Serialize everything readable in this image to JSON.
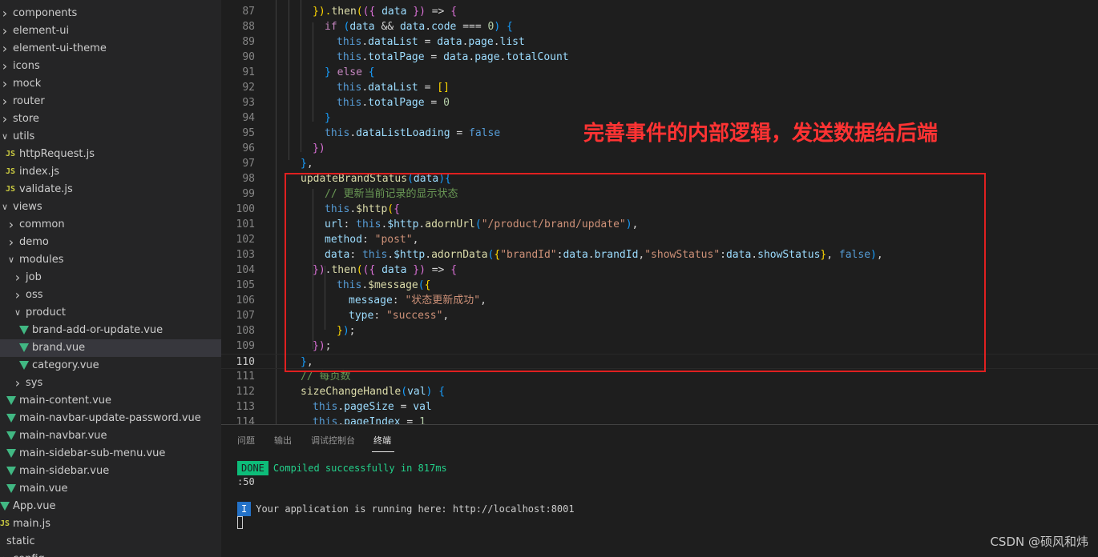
{
  "explorer": {
    "items": [
      {
        "label": "components",
        "kind": "folder",
        "open": false
      },
      {
        "label": "element-ui",
        "kind": "folder",
        "open": false
      },
      {
        "label": "element-ui-theme",
        "kind": "folder",
        "open": false
      },
      {
        "label": "icons",
        "kind": "folder",
        "open": false
      },
      {
        "label": "mock",
        "kind": "folder",
        "open": false
      },
      {
        "label": "router",
        "kind": "folder",
        "open": false
      },
      {
        "label": "store",
        "kind": "folder",
        "open": false
      },
      {
        "label": "utils",
        "kind": "folder",
        "open": true
      },
      {
        "label": "httpRequest.js",
        "kind": "js",
        "icon_text": "JS"
      },
      {
        "label": "index.js",
        "kind": "js",
        "icon_text": "JS"
      },
      {
        "label": "validate.js",
        "kind": "js",
        "icon_text": "JS"
      },
      {
        "label": "views",
        "kind": "folder",
        "open": true
      },
      {
        "label": "common",
        "kind": "folder",
        "open": false
      },
      {
        "label": "demo",
        "kind": "folder",
        "open": false
      },
      {
        "label": "modules",
        "kind": "folder",
        "open": true
      },
      {
        "label": "job",
        "kind": "folder",
        "open": false
      },
      {
        "label": "oss",
        "kind": "folder",
        "open": false
      },
      {
        "label": "product",
        "kind": "folder",
        "open": true
      },
      {
        "label": "brand-add-or-update.vue",
        "kind": "vue"
      },
      {
        "label": "brand.vue",
        "kind": "vue",
        "selected": true
      },
      {
        "label": "category.vue",
        "kind": "vue"
      },
      {
        "label": "sys",
        "kind": "folder",
        "open": false
      },
      {
        "label": "main-content.vue",
        "kind": "vue"
      },
      {
        "label": "main-navbar-update-password.vue",
        "kind": "vue"
      },
      {
        "label": "main-navbar.vue",
        "kind": "vue"
      },
      {
        "label": "main-sidebar-sub-menu.vue",
        "kind": "vue"
      },
      {
        "label": "main-sidebar.vue",
        "kind": "vue"
      },
      {
        "label": "main.vue",
        "kind": "vue"
      },
      {
        "label": "App.vue",
        "kind": "vue"
      },
      {
        "label": "main.js",
        "kind": "js",
        "icon_text": "JS"
      },
      {
        "label": "static",
        "kind": "folder",
        "open": true
      },
      {
        "label": "config",
        "kind": "folder",
        "open": false
      }
    ]
  },
  "editor": {
    "active_line": "110",
    "lines": [
      {
        "n": "87",
        "tokens": [
          [
            "p",
            "})."
          ],
          [
            "fn",
            "then"
          ],
          [
            "p1",
            "("
          ],
          [
            "p2",
            "({"
          ],
          [
            "prop",
            " data "
          ],
          [
            "p2",
            "})"
          ],
          [
            "op",
            " => "
          ],
          [
            "p2",
            "{"
          ]
        ]
      },
      {
        "n": "88",
        "tokens": [
          [
            "kw",
            "if"
          ],
          [
            "op",
            " "
          ],
          [
            "p3",
            "("
          ],
          [
            "prop",
            "data"
          ],
          [
            "op",
            " && "
          ],
          [
            "prop",
            "data"
          ],
          [
            "op",
            "."
          ],
          [
            "prop",
            "code"
          ],
          [
            "op",
            " === "
          ],
          [
            "num",
            "0"
          ],
          [
            "p3",
            ")"
          ],
          [
            "op",
            " "
          ],
          [
            "p3",
            "{"
          ]
        ]
      },
      {
        "n": "89",
        "tokens": [
          [
            "this",
            "this"
          ],
          [
            "op",
            "."
          ],
          [
            "prop",
            "dataList"
          ],
          [
            "op",
            " = "
          ],
          [
            "prop",
            "data"
          ],
          [
            "op",
            "."
          ],
          [
            "prop",
            "page"
          ],
          [
            "op",
            "."
          ],
          [
            "prop",
            "list"
          ]
        ]
      },
      {
        "n": "90",
        "tokens": [
          [
            "this",
            "this"
          ],
          [
            "op",
            "."
          ],
          [
            "prop",
            "totalPage"
          ],
          [
            "op",
            " = "
          ],
          [
            "prop",
            "data"
          ],
          [
            "op",
            "."
          ],
          [
            "prop",
            "page"
          ],
          [
            "op",
            "."
          ],
          [
            "prop",
            "totalCount"
          ]
        ]
      },
      {
        "n": "91",
        "tokens": [
          [
            "p3",
            "}"
          ],
          [
            "op",
            " "
          ],
          [
            "kw",
            "else"
          ],
          [
            "op",
            " "
          ],
          [
            "p3",
            "{"
          ]
        ]
      },
      {
        "n": "92",
        "tokens": [
          [
            "this",
            "this"
          ],
          [
            "op",
            "."
          ],
          [
            "prop",
            "dataList"
          ],
          [
            "op",
            " = "
          ],
          [
            "p1",
            "[]"
          ]
        ]
      },
      {
        "n": "93",
        "tokens": [
          [
            "this",
            "this"
          ],
          [
            "op",
            "."
          ],
          [
            "prop",
            "totalPage"
          ],
          [
            "op",
            " = "
          ],
          [
            "num",
            "0"
          ]
        ]
      },
      {
        "n": "94",
        "tokens": [
          [
            "p3",
            "}"
          ]
        ]
      },
      {
        "n": "95",
        "tokens": [
          [
            "this",
            "this"
          ],
          [
            "op",
            "."
          ],
          [
            "prop",
            "dataListLoading"
          ],
          [
            "op",
            " = "
          ],
          [
            "this",
            "false"
          ]
        ]
      },
      {
        "n": "96",
        "tokens": [
          [
            "p2",
            "})"
          ]
        ]
      },
      {
        "n": "97",
        "tokens": [
          [
            "p3",
            "}"
          ],
          [
            "op",
            ","
          ]
        ]
      },
      {
        "n": "98",
        "tokens": [
          [
            "fn",
            "updateBrandStatus"
          ],
          [
            "p3",
            "("
          ],
          [
            "prop",
            "data"
          ],
          [
            "p3",
            ")"
          ],
          [
            "p3",
            "{"
          ]
        ]
      },
      {
        "n": "99",
        "tokens": [
          [
            "cm",
            "// 更新当前记录的显示状态"
          ]
        ]
      },
      {
        "n": "100",
        "tokens": [
          [
            "this",
            "this"
          ],
          [
            "op",
            "."
          ],
          [
            "fn",
            "$http"
          ],
          [
            "p1",
            "("
          ],
          [
            "p2",
            "{"
          ]
        ]
      },
      {
        "n": "101",
        "tokens": [
          [
            "prop",
            "url"
          ],
          [
            "op",
            ": "
          ],
          [
            "this",
            "this"
          ],
          [
            "op",
            "."
          ],
          [
            "prop",
            "$http"
          ],
          [
            "op",
            "."
          ],
          [
            "fn",
            "adornUrl"
          ],
          [
            "p3",
            "("
          ],
          [
            "str",
            "\"/product/brand/update\""
          ],
          [
            "p3",
            ")"
          ],
          [
            "op",
            ","
          ]
        ]
      },
      {
        "n": "102",
        "tokens": [
          [
            "prop",
            "method"
          ],
          [
            "op",
            ": "
          ],
          [
            "str",
            "\"post\""
          ],
          [
            "op",
            ","
          ]
        ]
      },
      {
        "n": "103",
        "tokens": [
          [
            "prop",
            "data"
          ],
          [
            "op",
            ": "
          ],
          [
            "this",
            "this"
          ],
          [
            "op",
            "."
          ],
          [
            "prop",
            "$http"
          ],
          [
            "op",
            "."
          ],
          [
            "fn",
            "adornData"
          ],
          [
            "p3",
            "("
          ],
          [
            "p1",
            "{"
          ],
          [
            "str",
            "\"brandId\""
          ],
          [
            "op",
            ":"
          ],
          [
            "prop",
            "data"
          ],
          [
            "op",
            "."
          ],
          [
            "prop",
            "brandId"
          ],
          [
            "op",
            ","
          ],
          [
            "str",
            "\"showStatus\""
          ],
          [
            "op",
            ":"
          ],
          [
            "prop",
            "data"
          ],
          [
            "op",
            "."
          ],
          [
            "prop",
            "showStatus"
          ],
          [
            "p1",
            "}"
          ],
          [
            "op",
            ", "
          ],
          [
            "this",
            "false"
          ],
          [
            "p3",
            ")"
          ],
          [
            "op",
            ","
          ]
        ]
      },
      {
        "n": "104",
        "tokens": [
          [
            "p2",
            "})"
          ],
          [
            "op",
            "."
          ],
          [
            "fn",
            "then"
          ],
          [
            "p1",
            "("
          ],
          [
            "p2",
            "({"
          ],
          [
            "prop",
            " data "
          ],
          [
            "p2",
            "})"
          ],
          [
            "op",
            " => "
          ],
          [
            "p2",
            "{"
          ]
        ]
      },
      {
        "n": "105",
        "tokens": [
          [
            "this",
            "this"
          ],
          [
            "op",
            "."
          ],
          [
            "fn",
            "$message"
          ],
          [
            "p3",
            "("
          ],
          [
            "p1",
            "{"
          ]
        ]
      },
      {
        "n": "106",
        "tokens": [
          [
            "prop",
            "message"
          ],
          [
            "op",
            ": "
          ],
          [
            "str",
            "\"状态更新成功\""
          ],
          [
            "op",
            ","
          ]
        ]
      },
      {
        "n": "107",
        "tokens": [
          [
            "prop",
            "type"
          ],
          [
            "op",
            ": "
          ],
          [
            "str",
            "\"success\""
          ],
          [
            "op",
            ","
          ]
        ]
      },
      {
        "n": "108",
        "tokens": [
          [
            "p1",
            "}"
          ],
          [
            "p3",
            ")"
          ],
          [
            "op",
            ";"
          ]
        ]
      },
      {
        "n": "109",
        "tokens": [
          [
            "p2",
            "})"
          ],
          [
            "op",
            ";"
          ]
        ]
      },
      {
        "n": "110",
        "tokens": [
          [
            "p3",
            "}"
          ],
          [
            "op",
            ","
          ]
        ]
      },
      {
        "n": "111",
        "tokens": [
          [
            "cm",
            "// 每页数"
          ]
        ]
      },
      {
        "n": "112",
        "tokens": [
          [
            "fn",
            "sizeChangeHandle"
          ],
          [
            "p3",
            "("
          ],
          [
            "prop",
            "val"
          ],
          [
            "p3",
            ")"
          ],
          [
            "op",
            " "
          ],
          [
            "p3",
            "{"
          ]
        ]
      },
      {
        "n": "113",
        "tokens": [
          [
            "this",
            "this"
          ],
          [
            "op",
            "."
          ],
          [
            "prop",
            "pageSize"
          ],
          [
            "op",
            " = "
          ],
          [
            "prop",
            "val"
          ]
        ]
      },
      {
        "n": "114",
        "tokens": [
          [
            "this",
            "this"
          ],
          [
            "op",
            "."
          ],
          [
            "prop",
            "pageIndex"
          ],
          [
            "op",
            " = "
          ],
          [
            "num",
            "1"
          ]
        ]
      }
    ]
  },
  "annotation": {
    "text": "完善事件的内部逻辑，发送数据给后端",
    "color": "#ff3333"
  },
  "panel": {
    "tabs": [
      "问题",
      "输出",
      "调试控制台",
      "终端"
    ],
    "active_tab": "终端",
    "terminal": {
      "done_badge": "DONE",
      "compiled_text": "Compiled successfully in 817ms",
      "time_suffix": ":50",
      "info_badge": "I",
      "running_text": "Your application is running here: http://localhost:8001"
    }
  },
  "watermark": "CSDN @硕风和炜"
}
